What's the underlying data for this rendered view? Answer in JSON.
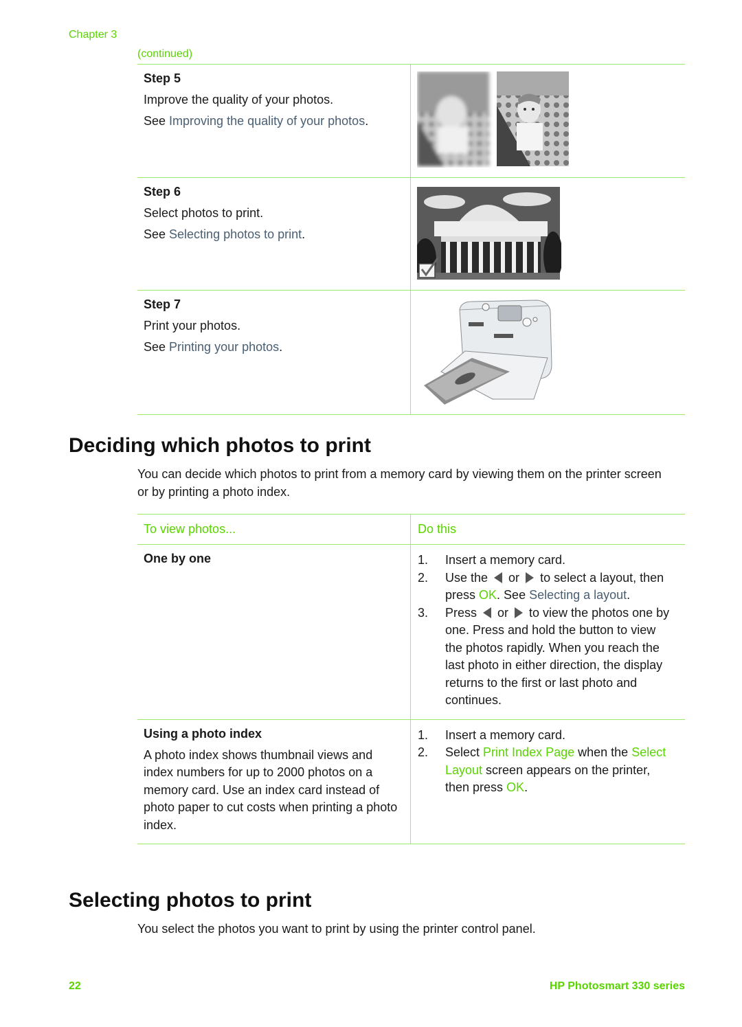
{
  "header": {
    "chapter": "Chapter 3",
    "continued": "(continued)"
  },
  "steps": [
    {
      "title": "Step 5",
      "line1": "Improve the quality of your photos.",
      "see": "See ",
      "link": "Improving the quality of your photos",
      "end": ".",
      "image": "blurry-and-sharp-photo-comparison"
    },
    {
      "title": "Step 6",
      "line1": "Select photos to print.",
      "see": "See ",
      "link": "Selecting photos to print",
      "end": ".",
      "image": "selected-building-photo-with-checkmark"
    },
    {
      "title": "Step 7",
      "line1": "Print your photos.",
      "see": "See ",
      "link": "Printing your photos",
      "end": ".",
      "image": "photo-printer-printing"
    }
  ],
  "section1": {
    "heading": "Deciding which photos to print",
    "intro": "You can decide which photos to print from a memory card by viewing them on the printer screen or by printing a photo index."
  },
  "table": {
    "col1": "To view photos...",
    "col2": "Do this",
    "rows": [
      {
        "title": "One by one",
        "items": {
          "i1_num": "1.",
          "i1": "Insert a memory card.",
          "i2_num": "2.",
          "i2_a": "Use the ",
          "i2_or": " or ",
          "i2_b": " to select a layout, then press ",
          "i2_ok": "OK",
          "i2_c": ". See ",
          "i2_link": "Selecting a layout",
          "i2_end": ".",
          "i3_num": "3.",
          "i3_a": "Press ",
          "i3_or": " or ",
          "i3_b": " to view the photos one by one. Press and hold the button to view the photos rapidly. When you reach the last photo in either direction, the display returns to the first or last photo and continues."
        }
      },
      {
        "title": "Using a photo index",
        "desc": "A photo index shows thumbnail views and index numbers for up to 2000 photos on a memory card. Use an index card instead of photo paper to cut costs when printing a photo index.",
        "items": {
          "i1_num": "1.",
          "i1": "Insert a memory card.",
          "i2_num": "2.",
          "i2_a": "Select ",
          "i2_hl1": "Print Index Page",
          "i2_b": " when the ",
          "i2_hl2": "Select Layout",
          "i2_c": " screen appears on the printer, then press ",
          "i2_ok": "OK",
          "i2_end": "."
        }
      }
    ]
  },
  "section2": {
    "heading": "Selecting photos to print",
    "intro": "You select the photos you want to print by using the printer control panel."
  },
  "footer": {
    "page": "22",
    "product": "HP Photosmart 330 series"
  },
  "colors": {
    "accent_green": "#5ad400",
    "link": "#4a5e72",
    "rule": "#9be86a"
  }
}
